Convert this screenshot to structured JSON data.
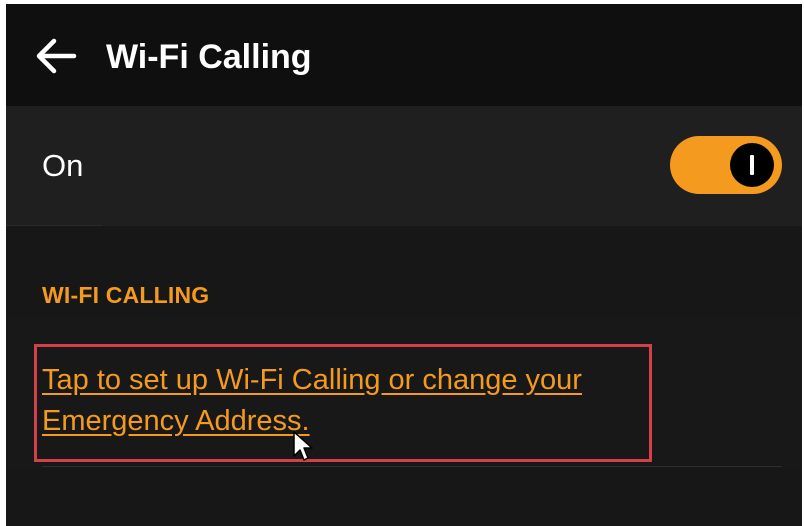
{
  "header": {
    "back_icon": "arrow-left-icon",
    "title": "Wi-Fi Calling"
  },
  "toggle": {
    "label": "On",
    "state": true,
    "color": "#f49a1e"
  },
  "section": {
    "title": "WI-FI CALLING",
    "link_lines": [
      "Tap to set up Wi-Fi Calling or change your",
      "Emergency Address."
    ]
  },
  "colors": {
    "background": "#171717",
    "accent": "#f49a1e",
    "highlight": "#d2404a",
    "text": "#ffffff"
  }
}
